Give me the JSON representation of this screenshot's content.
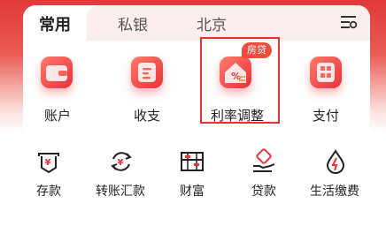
{
  "tabs": [
    {
      "label": "常用",
      "active": true
    },
    {
      "label": "私银",
      "active": false
    },
    {
      "label": "北京",
      "active": false
    }
  ],
  "main_functions": [
    {
      "label": "账户",
      "icon": "wallet-icon"
    },
    {
      "label": "收支",
      "icon": "list-icon"
    },
    {
      "label": "利率调整",
      "icon": "house-rate-icon",
      "badge": "房贷",
      "highlighted": true
    },
    {
      "label": "支付",
      "icon": "qr-pay-icon"
    }
  ],
  "secondary_functions": [
    {
      "label": "存款",
      "icon": "deposit-icon"
    },
    {
      "label": "转账汇款",
      "icon": "transfer-icon"
    },
    {
      "label": "财富",
      "icon": "abacus-icon"
    },
    {
      "label": "贷款",
      "icon": "loan-icon"
    },
    {
      "label": "生活缴费",
      "icon": "utility-icon"
    }
  ],
  "colors": {
    "brand_red": "#e33b2e",
    "highlight_border": "#e8322d",
    "badge_bg": "#f04b3e"
  }
}
